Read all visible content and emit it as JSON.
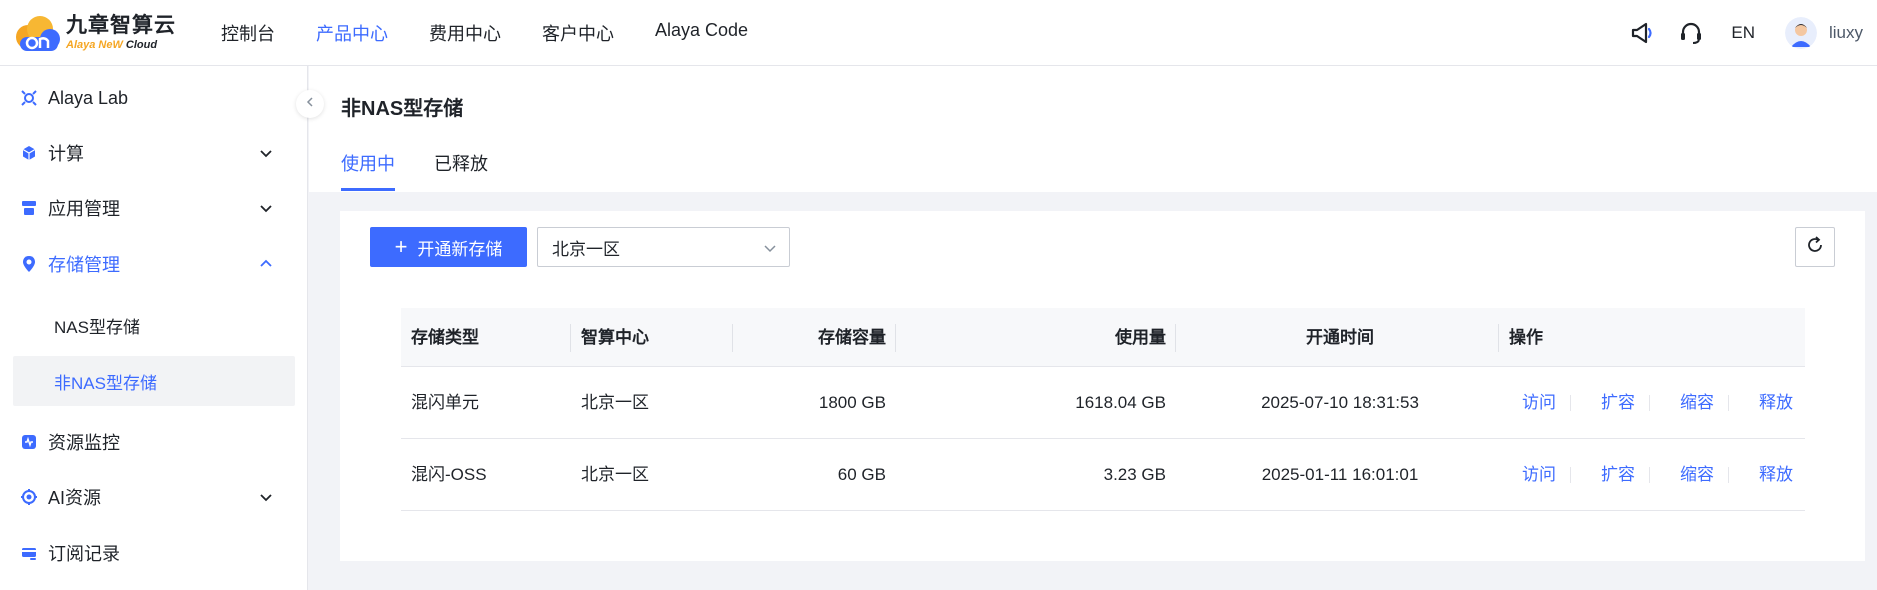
{
  "header": {
    "logo_cn": "九章智算云",
    "logo_en_a": "Alaya NeW",
    "logo_en_b": "Cloud",
    "nav": [
      {
        "label": "控制台"
      },
      {
        "label": "产品中心",
        "active": true
      },
      {
        "label": "费用中心"
      },
      {
        "label": "客户中心"
      },
      {
        "label": "Alaya Code"
      }
    ],
    "icons": [
      "megaphone-icon",
      "headset-icon"
    ],
    "lang": "EN",
    "username": "liuxy"
  },
  "sidebar": {
    "items": [
      {
        "label": "Alaya Lab",
        "icon": "lab-icon"
      },
      {
        "label": "计算",
        "icon": "cube-icon"
      },
      {
        "label": "应用管理",
        "icon": "app-icon"
      },
      {
        "label": "存储管理",
        "icon": "storage-icon",
        "expanded": true
      },
      {
        "label": "NAS型存储"
      },
      {
        "label": "非NAS型存储",
        "selected": true
      },
      {
        "label": "资源监控",
        "icon": "monitor-icon"
      },
      {
        "label": "AI资源",
        "icon": "ai-icon"
      },
      {
        "label": "订阅记录",
        "icon": "subscription-icon"
      }
    ]
  },
  "page": {
    "title": "非NAS型存储",
    "tabs": [
      {
        "label": "使用中",
        "active": true
      },
      {
        "label": "已释放"
      }
    ]
  },
  "toolbar": {
    "create_label": "开通新存储",
    "region_value": "北京一区"
  },
  "table": {
    "columns": [
      "存储类型",
      "智算中心",
      "存储容量",
      "使用量",
      "开通时间",
      "操作"
    ],
    "rows": [
      {
        "type": "混闪单元",
        "center": "北京一区",
        "capacity": "1800 GB",
        "usage": "1618.04 GB",
        "time": "2025-07-10 18:31:53"
      },
      {
        "type": "混闪-OSS",
        "center": "北京一区",
        "capacity": "60 GB",
        "usage": "3.23 GB",
        "time": "2025-01-11 16:01:01"
      }
    ],
    "actions": [
      "访问",
      "扩容",
      "缩容",
      "释放"
    ]
  },
  "colors": {
    "primary": "#3d6bff",
    "text": "#1f2329",
    "selected_bg": "#f2f3f5"
  }
}
